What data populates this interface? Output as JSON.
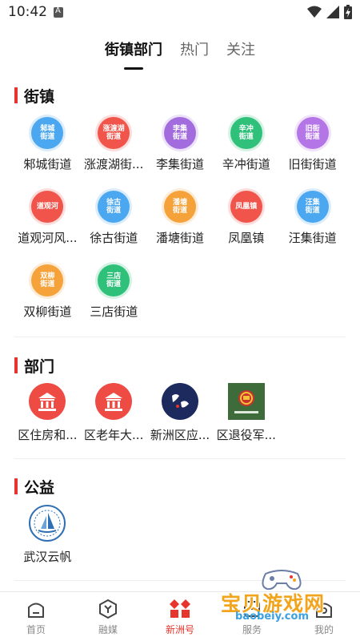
{
  "status_bar": {
    "time": "10:42"
  },
  "tabs": [
    {
      "label": "街镇部门"
    },
    {
      "label": "热门"
    },
    {
      "label": "关注"
    }
  ],
  "sections": {
    "towns": {
      "title": "街镇",
      "items": [
        {
          "label": "邾城街道",
          "icon_text": [
            "邾城",
            "街道"
          ],
          "color": "#4ba7ef"
        },
        {
          "label": "涨渡湖街...",
          "icon_text": [
            "涨渡湖",
            "街道"
          ],
          "color": "#f0544a"
        },
        {
          "label": "李集街道",
          "icon_text": [
            "李集",
            "街道"
          ],
          "color": "#a26cdf"
        },
        {
          "label": "辛冲街道",
          "icon_text": [
            "辛冲",
            "街道"
          ],
          "color": "#2fc07a"
        },
        {
          "label": "旧街街道",
          "icon_text": [
            "旧街",
            "街道"
          ],
          "color": "#b475e6"
        },
        {
          "label": "道观河风...",
          "icon_text": [
            "道观河",
            ""
          ],
          "color": "#f0544a"
        },
        {
          "label": "徐古街道",
          "icon_text": [
            "徐古",
            "街道"
          ],
          "color": "#4ba7ef"
        },
        {
          "label": "潘塘街道",
          "icon_text": [
            "潘塘",
            "街道"
          ],
          "color": "#f5a23a"
        },
        {
          "label": "凤凰镇",
          "icon_text": [
            "凤凰镇",
            ""
          ],
          "color": "#f0544a"
        },
        {
          "label": "汪集街道",
          "icon_text": [
            "汪集",
            "街道"
          ],
          "color": "#4ba7ef"
        },
        {
          "label": "双柳街道",
          "icon_text": [
            "双柳",
            "街道"
          ],
          "color": "#f5a23a"
        },
        {
          "label": "三店街道",
          "icon_text": [
            "三店",
            "街道"
          ],
          "color": "#2fc07a"
        }
      ]
    },
    "departments": {
      "title": "部门",
      "items": [
        {
          "label": "区住房和...",
          "icon": "bank-icon"
        },
        {
          "label": "区老年大...",
          "icon": "bank-icon"
        },
        {
          "label": "新洲区应...",
          "icon": "emergency-logo-icon"
        },
        {
          "label": "区退役军...",
          "icon": "national-emblem-icon"
        }
      ]
    },
    "welfare": {
      "title": "公益",
      "items": [
        {
          "label": "武汉云帆",
          "icon": "sailboat-logo-icon"
        }
      ]
    }
  },
  "bottom_nav": [
    {
      "label": "首页",
      "icon": "home-icon"
    },
    {
      "label": "融媒",
      "icon": "media-icon"
    },
    {
      "label": "新洲号",
      "icon": "xinzhou-hao-icon"
    },
    {
      "label": "服务",
      "icon": "service-icon"
    },
    {
      "label": "我的",
      "icon": "profile-icon"
    }
  ],
  "watermark": {
    "text": "宝贝游戏网",
    "url": "baobeiy.com"
  },
  "colors": {
    "accent": "#e5352d",
    "section_marker": "#e5352d"
  }
}
